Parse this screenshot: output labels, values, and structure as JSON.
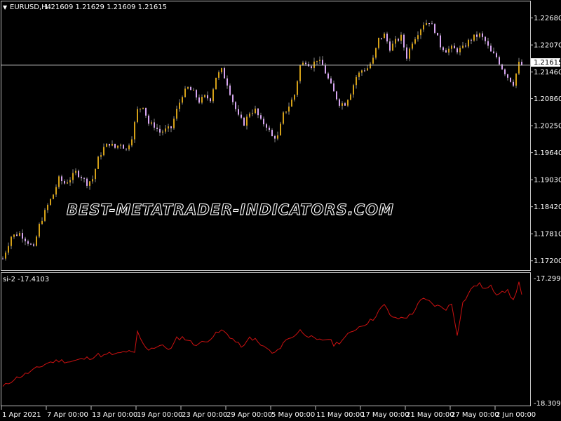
{
  "header": {
    "symbol": "EURUSD,H4",
    "ohlc": "1.21609 1.21629 1.21609 1.21615",
    "dropdown_glyph": "▼"
  },
  "watermark": "BEST-METATRADER-INDICATORS.COM",
  "colors": {
    "background": "#000000",
    "frame": "#c0c0c0",
    "bull": "#d4a017",
    "bear": "#d7a6f2",
    "wick": "#888888",
    "price_line": "#c0c0c0",
    "indicator": "#cc1111",
    "text": "#ffffff"
  },
  "price_axis": {
    "ticks": [
      "1.22680",
      "1.22070",
      "1.21460",
      "1.20860",
      "1.20250",
      "1.19640",
      "1.19030",
      "1.18420",
      "1.17810",
      "1.17200"
    ],
    "current_label": "1.21615"
  },
  "indicator": {
    "label": "si-2 -17.4103",
    "axis_top": "-17.2994",
    "axis_bottom": "-18.3098"
  },
  "time_axis": {
    "ticks": [
      "1 Apr 2021",
      "7 Apr 00:00",
      "13 Apr 00:00",
      "19 Apr 00:00",
      "23 Apr 00:00",
      "29 Apr 00:00",
      "5 May 00:00",
      "11 May 00:00",
      "17 May 00:00",
      "21 May 00:00",
      "27 May 00:00",
      "2 Jun 00:00"
    ]
  },
  "chart_data": [
    {
      "type": "candlestick",
      "title": "EURUSD,H4",
      "ylim": [
        1.171,
        1.228
      ],
      "current_price": 1.21615,
      "close_path": [
        [
          0,
          1.1725
        ],
        [
          3,
          1.1775
        ],
        [
          6,
          1.1782
        ],
        [
          9,
          1.1762
        ],
        [
          11,
          1.1748
        ],
        [
          13,
          1.18
        ],
        [
          16,
          1.1845
        ],
        [
          18,
          1.187
        ],
        [
          20,
          1.1905
        ],
        [
          22,
          1.1895
        ],
        [
          24,
          1.1905
        ],
        [
          26,
          1.192
        ],
        [
          28,
          1.191
        ],
        [
          30,
          1.1895
        ],
        [
          32,
          1.1905
        ],
        [
          34,
          1.195
        ],
        [
          36,
          1.1975
        ],
        [
          38,
          1.1985
        ],
        [
          40,
          1.1975
        ],
        [
          42,
          1.1985
        ],
        [
          44,
          1.197
        ],
        [
          46,
          1.2
        ],
        [
          48,
          1.206
        ],
        [
          50,
          1.207
        ],
        [
          52,
          1.203
        ],
        [
          54,
          1.2025
        ],
        [
          56,
          1.201
        ],
        [
          58,
          1.2015
        ],
        [
          60,
          1.202
        ],
        [
          62,
          1.206
        ],
        [
          64,
          1.2095
        ],
        [
          66,
          1.211
        ],
        [
          68,
          1.21
        ],
        [
          70,
          1.208
        ],
        [
          72,
          1.209
        ],
        [
          74,
          1.2085
        ],
        [
          76,
          1.2135
        ],
        [
          78,
          1.215
        ],
        [
          80,
          1.212
        ],
        [
          82,
          1.208
        ],
        [
          84,
          1.2045
        ],
        [
          86,
          1.203
        ],
        [
          88,
          1.2055
        ],
        [
          90,
          1.206
        ],
        [
          92,
          1.2035
        ],
        [
          94,
          1.2025
        ],
        [
          96,
          1.2
        ],
        [
          98,
          1.2
        ],
        [
          100,
          1.205
        ],
        [
          102,
          1.207
        ],
        [
          104,
          1.2095
        ],
        [
          106,
          1.216
        ],
        [
          108,
          1.217
        ],
        [
          110,
          1.216
        ],
        [
          112,
          1.2175
        ],
        [
          114,
          1.216
        ],
        [
          116,
          1.213
        ],
        [
          118,
          1.21
        ],
        [
          120,
          1.2075
        ],
        [
          122,
          1.2075
        ],
        [
          124,
          1.21
        ],
        [
          126,
          1.2135
        ],
        [
          128,
          1.215
        ],
        [
          130,
          1.2155
        ],
        [
          132,
          1.2175
        ],
        [
          134,
          1.222
        ],
        [
          136,
          1.223
        ],
        [
          138,
          1.22
        ],
        [
          140,
          1.2215
        ],
        [
          142,
          1.2225
        ],
        [
          144,
          1.218
        ],
        [
          146,
          1.2215
        ],
        [
          148,
          1.2235
        ],
        [
          150,
          1.2255
        ],
        [
          152,
          1.226
        ],
        [
          154,
          1.224
        ],
        [
          156,
          1.2205
        ],
        [
          158,
          1.2195
        ],
        [
          160,
          1.22
        ],
        [
          162,
          1.2195
        ],
        [
          164,
          1.22
        ],
        [
          166,
          1.2215
        ],
        [
          168,
          1.2225
        ],
        [
          170,
          1.223
        ],
        [
          172,
          1.2215
        ],
        [
          174,
          1.219
        ],
        [
          176,
          1.218
        ],
        [
          178,
          1.2155
        ],
        [
          180,
          1.2135
        ],
        [
          182,
          1.212
        ],
        [
          184,
          1.2165
        ],
        [
          185,
          1.21615
        ]
      ]
    },
    {
      "type": "line",
      "title": "si-2 -17.4103",
      "ylim": [
        -18.3098,
        -17.2994
      ],
      "series": [
        {
          "color": "#cc1111",
          "points": [
            [
              0,
              -18.21
            ],
            [
              4,
              -18.14
            ],
            [
              8,
              -18.1
            ],
            [
              12,
              -18.05
            ],
            [
              16,
              -18.0
            ],
            [
              20,
              -17.98
            ],
            [
              24,
              -17.99
            ],
            [
              28,
              -17.97
            ],
            [
              32,
              -17.95
            ],
            [
              34,
              -17.93
            ],
            [
              36,
              -17.94
            ],
            [
              38,
              -17.92
            ],
            [
              40,
              -17.93
            ],
            [
              44,
              -17.9
            ],
            [
              47,
              -17.92
            ],
            [
              48,
              -17.73
            ],
            [
              50,
              -17.84
            ],
            [
              52,
              -17.88
            ],
            [
              56,
              -17.85
            ],
            [
              60,
              -17.88
            ],
            [
              62,
              -17.79
            ],
            [
              64,
              -17.78
            ],
            [
              66,
              -17.8
            ],
            [
              68,
              -17.84
            ],
            [
              72,
              -17.82
            ],
            [
              76,
              -17.75
            ],
            [
              78,
              -17.72
            ],
            [
              80,
              -17.75
            ],
            [
              84,
              -17.84
            ],
            [
              86,
              -17.86
            ],
            [
              88,
              -17.78
            ],
            [
              90,
              -17.8
            ],
            [
              92,
              -17.85
            ],
            [
              94,
              -17.87
            ],
            [
              96,
              -17.92
            ],
            [
              98,
              -17.9
            ],
            [
              100,
              -17.82
            ],
            [
              104,
              -17.76
            ],
            [
              106,
              -17.72
            ],
            [
              108,
              -17.75
            ],
            [
              110,
              -17.78
            ],
            [
              112,
              -17.81
            ],
            [
              116,
              -17.79
            ],
            [
              118,
              -17.84
            ],
            [
              120,
              -17.82
            ],
            [
              124,
              -17.74
            ],
            [
              126,
              -17.7
            ],
            [
              130,
              -17.65
            ],
            [
              132,
              -17.62
            ],
            [
              134,
              -17.55
            ],
            [
              136,
              -17.5
            ],
            [
              138,
              -17.58
            ],
            [
              140,
              -17.62
            ],
            [
              144,
              -17.6
            ],
            [
              146,
              -17.58
            ],
            [
              148,
              -17.48
            ],
            [
              150,
              -17.45
            ],
            [
              152,
              -17.47
            ],
            [
              154,
              -17.5
            ],
            [
              158,
              -17.53
            ],
            [
              160,
              -17.49
            ],
            [
              162,
              -17.75
            ],
            [
              164,
              -17.48
            ],
            [
              166,
              -17.4
            ],
            [
              168,
              -17.33
            ],
            [
              170,
              -17.32
            ],
            [
              172,
              -17.36
            ],
            [
              174,
              -17.34
            ],
            [
              176,
              -17.4
            ],
            [
              178,
              -17.37
            ],
            [
              180,
              -17.38
            ],
            [
              182,
              -17.46
            ],
            [
              184,
              -17.3
            ],
            [
              185,
              -17.41
            ]
          ]
        }
      ]
    }
  ]
}
